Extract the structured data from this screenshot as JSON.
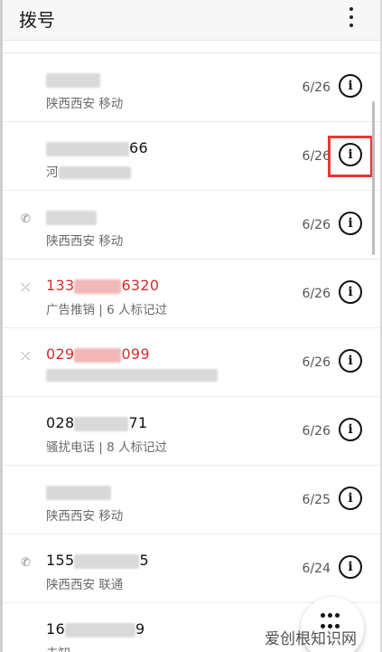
{
  "header": {
    "title": "拨号"
  },
  "calls": [
    {
      "name_visible": "",
      "name_suffix": "",
      "sub_visible": "陕西西安 移动",
      "date": "6/26",
      "missed": false,
      "icon": "none"
    },
    {
      "name_visible": "",
      "name_suffix": "66",
      "sub_visible": "河",
      "date": "6/26",
      "missed": false,
      "icon": "none"
    },
    {
      "name_visible": "",
      "name_suffix": "",
      "sub_visible": "陕西西安 移动",
      "date": "6/26",
      "missed": false,
      "icon": "outgoing-call-icon"
    },
    {
      "name_visible": "133",
      "name_suffix": "6320",
      "sub_visible": "广告推销 | 6 人标记过",
      "date": "6/26",
      "missed": true,
      "icon": "missed-call-icon"
    },
    {
      "name_visible": "029",
      "name_suffix": "099",
      "sub_visible": "",
      "date": "6/26",
      "missed": true,
      "icon": "missed-call-icon"
    },
    {
      "name_visible": "028",
      "name_suffix": "71",
      "sub_visible": "骚扰电话 | 8 人标记过",
      "date": "6/26",
      "missed": false,
      "icon": "none"
    },
    {
      "name_visible": "",
      "name_suffix": "",
      "sub_visible": "陕西西安 移动",
      "date": "6/25",
      "missed": false,
      "icon": "none"
    },
    {
      "name_visible": "155",
      "name_suffix": "5",
      "sub_visible": "陕西西安 联通",
      "date": "6/24",
      "missed": false,
      "icon": "incoming-call-icon"
    },
    {
      "name_visible": "16",
      "name_suffix": "9",
      "sub_visible": "未知",
      "date": "",
      "missed": false,
      "icon": "none"
    }
  ],
  "icons": {
    "info": "info-icon",
    "menu": "more-vert-icon",
    "dialpad": "dialpad-icon"
  },
  "watermark": "爱创根知识网",
  "colors": {
    "missed": "#d32f2f",
    "highlight": "#e53935"
  }
}
